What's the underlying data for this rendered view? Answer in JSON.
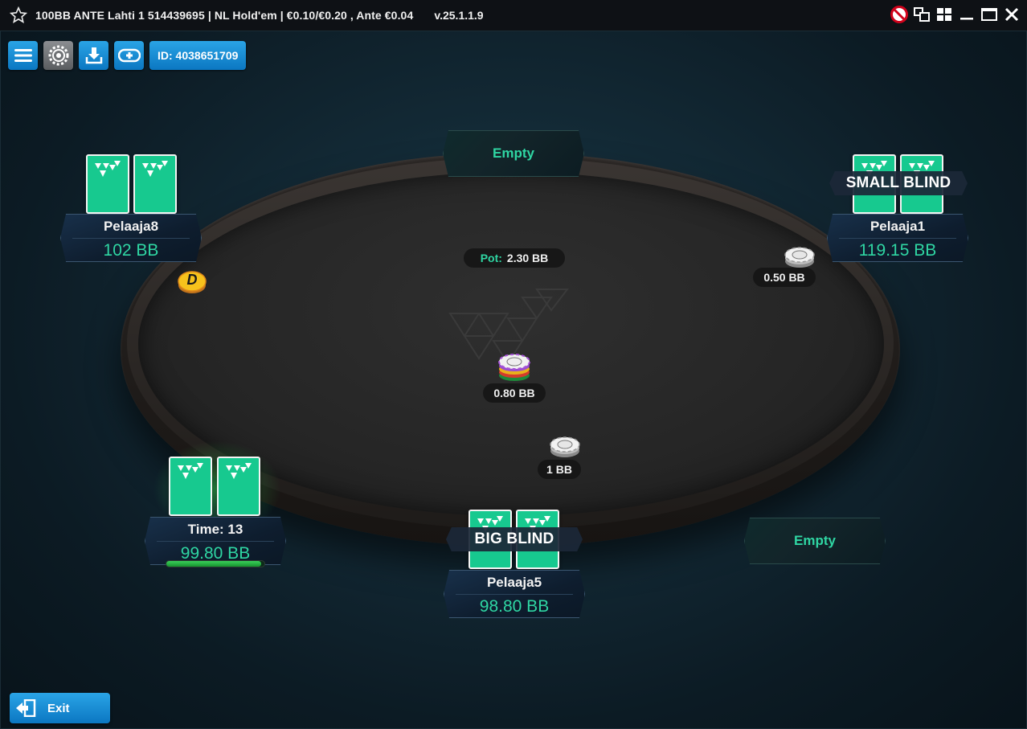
{
  "window": {
    "title": "100BB ANTE Lahti 1 514439695 | NL Hold'em | €0.10/€0.20 , Ante €0.04",
    "version": "v.25.1.1.9",
    "controls": [
      "no-sound-icon",
      "windows-icon",
      "tile-icon",
      "minimize-icon",
      "maximize-icon",
      "close-icon"
    ]
  },
  "toolbar": {
    "buttons": [
      "menu-icon",
      "settings-icon",
      "download-icon",
      "add-chips-icon"
    ],
    "id_label": "ID: 4038651709"
  },
  "table": {
    "pot_label": "Pot:",
    "pot_value": "2.30 BB",
    "center_bet": "0.80 BB",
    "dealer_label": "D"
  },
  "seats": {
    "top": {
      "label": "Empty"
    },
    "top_left": {
      "name": "Pelaaja8",
      "stack": "102 BB"
    },
    "top_right": {
      "name": "Pelaaja1",
      "stack": "119.15 BB",
      "banner": "SMALL BLIND",
      "bet": "0.50 BB"
    },
    "bottom_left": {
      "name": "Time: 13",
      "stack": "99.80 BB",
      "timer_fraction": 0.97
    },
    "bottom": {
      "name": "Pelaaja5",
      "stack": "98.80 BB",
      "banner": "BIG BLIND",
      "bet": "1 BB"
    },
    "bottom_right": {
      "label": "Empty"
    }
  },
  "footer": {
    "exit_label": "Exit"
  },
  "colors": {
    "accent": "#2fd6a3",
    "button_blue": "#1a8fd6",
    "card": "#17c98f"
  }
}
